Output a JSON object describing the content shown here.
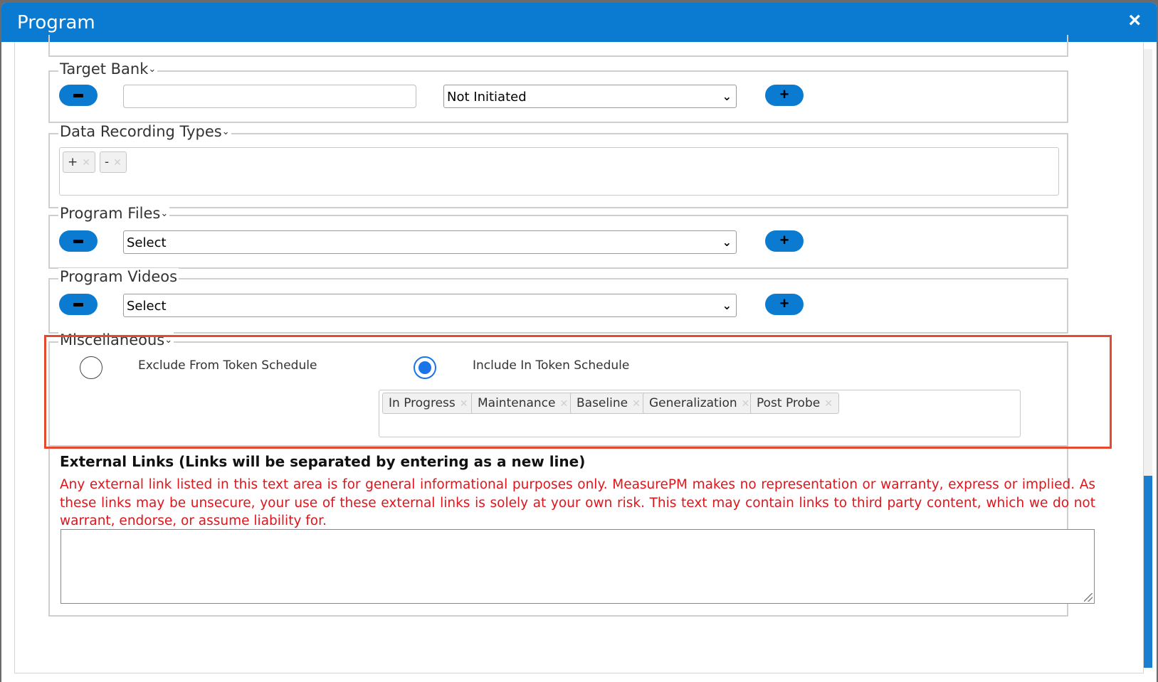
{
  "window": {
    "title": "Program",
    "close_icon": "×"
  },
  "sections": {
    "target_bank": {
      "legend": "Target Bank",
      "input_value": "",
      "status_select": "Not Initiated"
    },
    "data_recording_types": {
      "legend": "Data Recording Types",
      "tags": [
        "+",
        "-"
      ]
    },
    "program_files": {
      "legend": "Program Files",
      "select_value": "Select"
    },
    "program_videos": {
      "legend": "Program Videos",
      "select_value": "Select"
    },
    "miscellaneous": {
      "legend": "Miscellaneous",
      "radio_exclude_label": "Exclude From Token Schedule",
      "radio_include_label": "Include In Token Schedule",
      "selected_option": "Include In Token Schedule",
      "tags": [
        "In Progress",
        "Maintenance",
        "Baseline",
        "Generalization",
        "Post Probe"
      ]
    },
    "external_links": {
      "title": "External Links (Links will be separated by entering as a new line)",
      "notice": "Any external link listed in this text area is for general informational purposes only. MeasurePM makes no representation or warranty, express or implied. As these links may be unsecure, your use of these external links is solely at your own risk. This text may contain links to third party content, which we do not warrant, endorse, or assume liability for.",
      "value": ""
    }
  },
  "colors": {
    "title_bar": "#0a7bd0",
    "button": "#0a7bd0",
    "highlight_border": "#e64a2e",
    "notice_text": "#e1141b",
    "radio_selected": "#1a73e8"
  },
  "icons": {
    "remove_button": "minus-icon",
    "add_button": "plus-icon",
    "collapse": "chevron-down-icon",
    "tag_remove": "close-icon"
  }
}
